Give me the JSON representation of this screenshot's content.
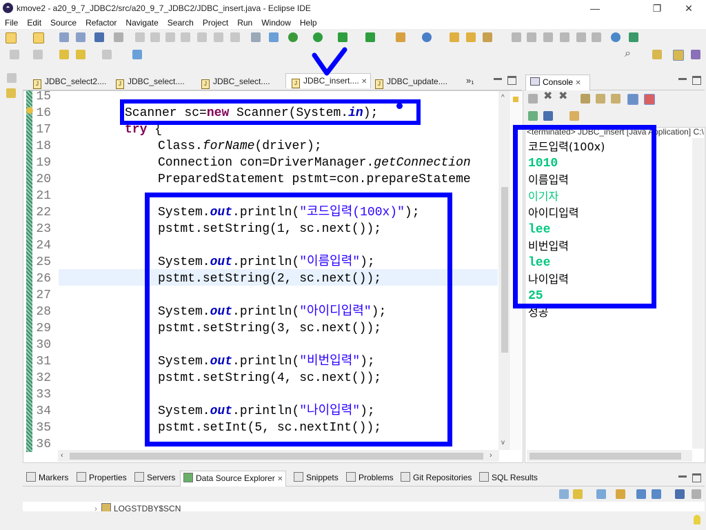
{
  "window": {
    "title": "kmove2 - a20_9_7_JDBC2/src/a20_9_7_JDBC2/JDBC_insert.java - Eclipse IDE",
    "app_icon": "eclipse-icon",
    "minimize": "—",
    "maximize": "❐",
    "close": "✕"
  },
  "menu": [
    "File",
    "Edit",
    "Source",
    "Refactor",
    "Navigate",
    "Search",
    "Project",
    "Run",
    "Window",
    "Help"
  ],
  "editor_tabs": [
    {
      "label": "JDBC_select2...."
    },
    {
      "label": "JDBC_select...."
    },
    {
      "label": "JDBC_select...."
    },
    {
      "label": "JDBC_insert....",
      "active": true,
      "close": "✕"
    },
    {
      "label": "JDBC_update...."
    }
  ],
  "editor_tabs_overflow": "»₁",
  "code_lines": [
    {
      "n": "15"
    },
    {
      "n": "16"
    },
    {
      "n": "17"
    },
    {
      "n": "18"
    },
    {
      "n": "19"
    },
    {
      "n": "20"
    },
    {
      "n": "21"
    },
    {
      "n": "22"
    },
    {
      "n": "23"
    },
    {
      "n": "24"
    },
    {
      "n": "25"
    },
    {
      "n": "26"
    },
    {
      "n": "27"
    },
    {
      "n": "28"
    },
    {
      "n": "29"
    },
    {
      "n": "30"
    },
    {
      "n": "31"
    },
    {
      "n": "32"
    },
    {
      "n": "33"
    },
    {
      "n": "34"
    },
    {
      "n": "35"
    },
    {
      "n": "36"
    }
  ],
  "code": {
    "l16a": "Scanner ",
    "l16b": "sc",
    "l16c": "=",
    "l16d": "new",
    "l16e": " Scanner(System.",
    "l16f": "in",
    "l16g": ");",
    "l17a": "try",
    "l17b": " {",
    "l18a": "Class.",
    "l18b": "forName",
    "l18c": "(driver);",
    "l19a": "Connection ",
    "l19b": "con",
    "l19c": "=DriverManager.",
    "l19d": "getConnection",
    "l20a": "PreparedStatement ",
    "l20b": "pstmt",
    "l20c": "=con.prepareStateme",
    "sys": "System.",
    "out": "out",
    "println": ".println(",
    "s22": "\"코드입력(100x)\"",
    "end": ");",
    "set23a": "pstmt",
    "set23b": ".setString(1, ",
    "sc": "sc",
    "next": ".next());",
    "s25": "\"이름입력\"",
    "set26b": ".setString(2, ",
    "s28": "\"아이디입력\"",
    "set29b": ".setString(3, ",
    "s31": "\"비번입력\"",
    "set32b": ".setString(4, ",
    "s34": "\"나이입력\"",
    "set35b": ".setInt(5, ",
    "nextInt": ".nextInt());"
  },
  "console": {
    "tab_label": "Console",
    "tab_close": "✕",
    "terminated": "<terminated> JDBC_insert [Java Application] C:\\",
    "lines": [
      {
        "text": "코드입력(100x)",
        "kind": "out"
      },
      {
        "text": "1010",
        "kind": "in"
      },
      {
        "text": "이름입력",
        "kind": "out"
      },
      {
        "text": "이기자",
        "kind": "in"
      },
      {
        "text": "아이디입력",
        "kind": "out"
      },
      {
        "text": "lee",
        "kind": "in"
      },
      {
        "text": "비번입력",
        "kind": "out"
      },
      {
        "text": "lee",
        "kind": "in"
      },
      {
        "text": "나이입력",
        "kind": "out"
      },
      {
        "text": "25",
        "kind": "in"
      },
      {
        "text": "성공",
        "kind": "out"
      }
    ]
  },
  "bottom_tabs": [
    "Markers",
    "Properties",
    "Servers",
    "Data Source Explorer",
    "Snippets",
    "Problems",
    "Git Repositories",
    "SQL Results"
  ],
  "bottom_tab_close": "✕",
  "bottom_tree_item": "LOGSTDBY$SCN",
  "annotation_color": "#0000ff",
  "colors": {
    "keyword": "#7f0055",
    "string": "#2a00ff",
    "field": "#0000c0",
    "console_input": "#00c87d"
  }
}
